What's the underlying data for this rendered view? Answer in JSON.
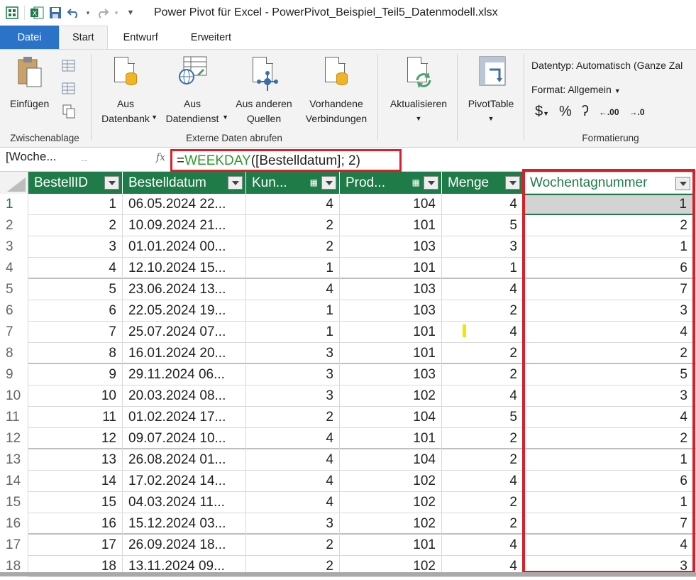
{
  "window": {
    "title": "Power Pivot für Excel - PowerPivot_Beispiel_Teil5_Datenmodell.xlsx"
  },
  "tabs": [
    {
      "label": "Datei"
    },
    {
      "label": "Start"
    },
    {
      "label": "Entwurf"
    },
    {
      "label": "Erweitert"
    }
  ],
  "ribbon": {
    "clipboard": {
      "paste_label": "Einfügen",
      "group_label": "Zwischenablage"
    },
    "external": {
      "from_db_line1": "Aus",
      "from_db_line2": "Datenbank",
      "from_service_line1": "Aus",
      "from_service_line2": "Datendienst",
      "from_other_line1": "Aus anderen",
      "from_other_line2": "Quellen",
      "existing_line1": "Vorhandene",
      "existing_line2": "Verbindungen",
      "group_label": "Externe Daten abrufen"
    },
    "refresh_label": "Aktualisieren",
    "pivot_label": "PivotTable",
    "formatting": {
      "datatype": "Datentyp: Automatisch (Ganze Zal",
      "format": "Format: Allgemein",
      "currency": "$",
      "percent": "%",
      "thousands": "ʔ",
      "dec_increase": "⁰.00",
      "dec_decrease": ".00",
      "group_label": "Formatierung"
    }
  },
  "formula_bar": {
    "name_box": "[Woche...",
    "fx": "fx",
    "formula_eq": "=",
    "formula_fn": "WEEKDAY",
    "formula_args": "([Bestelldatum]; 2)"
  },
  "table": {
    "columns": [
      {
        "label": "BestellID"
      },
      {
        "label": "Bestelldatum"
      },
      {
        "label": "Kun..."
      },
      {
        "label": "Prod..."
      },
      {
        "label": "Menge"
      },
      {
        "label": "Wochentagnummer"
      }
    ],
    "rows": [
      {
        "n": "1",
        "id": "1",
        "date": "06.05.2024 22...",
        "kun": "4",
        "prod": "104",
        "menge": "4",
        "wt": "1"
      },
      {
        "n": "2",
        "id": "2",
        "date": "10.09.2024 21...",
        "kun": "2",
        "prod": "101",
        "menge": "5",
        "wt": "2"
      },
      {
        "n": "3",
        "id": "3",
        "date": "01.01.2024 00...",
        "kun": "2",
        "prod": "103",
        "menge": "3",
        "wt": "1"
      },
      {
        "n": "4",
        "id": "4",
        "date": "12.10.2024 15...",
        "kun": "1",
        "prod": "101",
        "menge": "1",
        "wt": "6"
      },
      {
        "n": "5",
        "id": "5",
        "date": "23.06.2024 13...",
        "kun": "4",
        "prod": "103",
        "menge": "4",
        "wt": "7"
      },
      {
        "n": "6",
        "id": "6",
        "date": "22.05.2024 19...",
        "kun": "1",
        "prod": "103",
        "menge": "2",
        "wt": "3"
      },
      {
        "n": "7",
        "id": "7",
        "date": "25.07.2024 07...",
        "kun": "1",
        "prod": "101",
        "menge": "4",
        "wt": "4"
      },
      {
        "n": "8",
        "id": "8",
        "date": "16.01.2024 20...",
        "kun": "3",
        "prod": "101",
        "menge": "2",
        "wt": "2"
      },
      {
        "n": "9",
        "id": "9",
        "date": "29.11.2024 06...",
        "kun": "3",
        "prod": "103",
        "menge": "2",
        "wt": "5"
      },
      {
        "n": "10",
        "id": "10",
        "date": "20.03.2024 08...",
        "kun": "3",
        "prod": "102",
        "menge": "4",
        "wt": "3"
      },
      {
        "n": "11",
        "id": "11",
        "date": "01.02.2024 17...",
        "kun": "2",
        "prod": "104",
        "menge": "5",
        "wt": "4"
      },
      {
        "n": "12",
        "id": "12",
        "date": "09.07.2024 10...",
        "kun": "4",
        "prod": "101",
        "menge": "2",
        "wt": "2"
      },
      {
        "n": "13",
        "id": "13",
        "date": "26.08.2024 01...",
        "kun": "4",
        "prod": "104",
        "menge": "2",
        "wt": "1"
      },
      {
        "n": "14",
        "id": "14",
        "date": "17.02.2024 14...",
        "kun": "4",
        "prod": "102",
        "menge": "4",
        "wt": "6"
      },
      {
        "n": "15",
        "id": "15",
        "date": "04.03.2024 11...",
        "kun": "4",
        "prod": "102",
        "menge": "2",
        "wt": "1"
      },
      {
        "n": "16",
        "id": "16",
        "date": "15.12.2024 03...",
        "kun": "3",
        "prod": "102",
        "menge": "2",
        "wt": "7"
      },
      {
        "n": "17",
        "id": "17",
        "date": "26.09.2024 18...",
        "kun": "2",
        "prod": "101",
        "menge": "4",
        "wt": "4"
      },
      {
        "n": "18",
        "id": "18",
        "date": "13.11.2024 09...",
        "kun": "2",
        "prod": "102",
        "menge": "4",
        "wt": "3"
      }
    ]
  },
  "colors": {
    "header_green": "#1f7c49",
    "highlight_red": "#d9202a",
    "file_tab_blue": "#2b73c8"
  }
}
